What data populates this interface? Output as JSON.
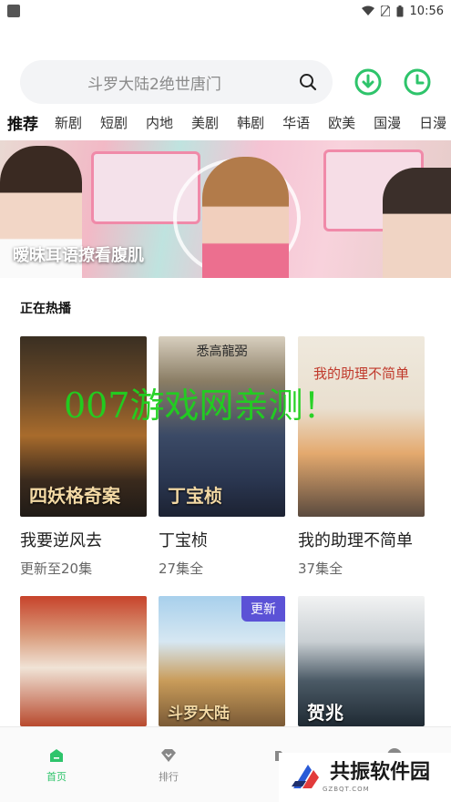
{
  "status_bar": {
    "time": "10:56"
  },
  "header": {
    "search_placeholder": "斗罗大陆2绝世唐门",
    "icons": [
      "search-icon",
      "download-icon",
      "history-icon"
    ],
    "accent_color": "#2ec46b"
  },
  "tabs": [
    {
      "label": "推荐",
      "active": true
    },
    {
      "label": "新剧"
    },
    {
      "label": "短剧"
    },
    {
      "label": "内地"
    },
    {
      "label": "美剧"
    },
    {
      "label": "韩剧"
    },
    {
      "label": "华语"
    },
    {
      "label": "欧美"
    },
    {
      "label": "国漫"
    },
    {
      "label": "日漫"
    }
  ],
  "banner": {
    "title": "暧昧耳语撩看腹肌"
  },
  "section": {
    "title": "正在热播"
  },
  "cards": [
    {
      "title": "我要逆风去",
      "subtitle": "更新至20集",
      "poster_text": "四妖格奇案"
    },
    {
      "title": "丁宝桢",
      "subtitle": "27集全",
      "poster_text": "丁宝桢",
      "poster_top": "悉高龍弼"
    },
    {
      "title": "我的助理不简单",
      "subtitle": "37集全",
      "poster_text": "我的助理不简单"
    },
    {
      "title": "",
      "subtitle": ""
    },
    {
      "title": "",
      "subtitle": "",
      "badge": "更新",
      "poster_text": "斗罗大陆"
    },
    {
      "title": "",
      "subtitle": "",
      "poster_text": "贺兆"
    }
  ],
  "watermark": "007游戏网亲测！",
  "bottom_nav": [
    {
      "label": "首页",
      "icon": "home-icon",
      "active": true
    },
    {
      "label": "排行",
      "icon": "ranking-icon"
    },
    {
      "label": "",
      "icon": "folder-icon"
    },
    {
      "label": "",
      "icon": "profile-icon"
    }
  ],
  "corner_logo": {
    "text": "共振软件园",
    "sub": "GZBQT.COM"
  }
}
